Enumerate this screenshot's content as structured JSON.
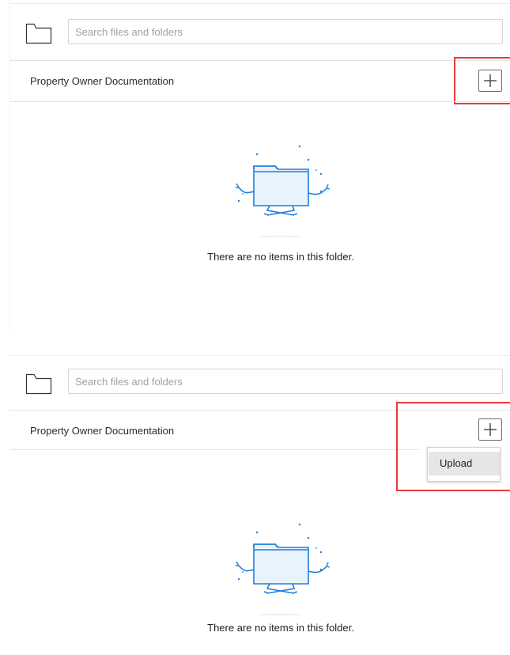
{
  "screens": [
    {
      "search": {
        "placeholder": "Search files and folders"
      },
      "header": {
        "title": "Property Owner Documentation",
        "add_icon": "plus-icon"
      },
      "empty_state": {
        "icon": "empty-folder-illustration",
        "message": "There are no items in this folder."
      },
      "highlight_color": "#e8393c"
    },
    {
      "search": {
        "placeholder": "Search files and folders"
      },
      "header": {
        "title": "Property Owner Documentation",
        "add_icon": "plus-icon"
      },
      "menu": {
        "items": [
          {
            "label": "Upload"
          }
        ]
      },
      "empty_state": {
        "icon": "empty-folder-illustration",
        "message": "There are no items in this folder."
      },
      "highlight_color": "#e8393c"
    }
  ],
  "colors": {
    "accent": "#1f7fd6",
    "illustration_fill": "#e9f3fc"
  }
}
